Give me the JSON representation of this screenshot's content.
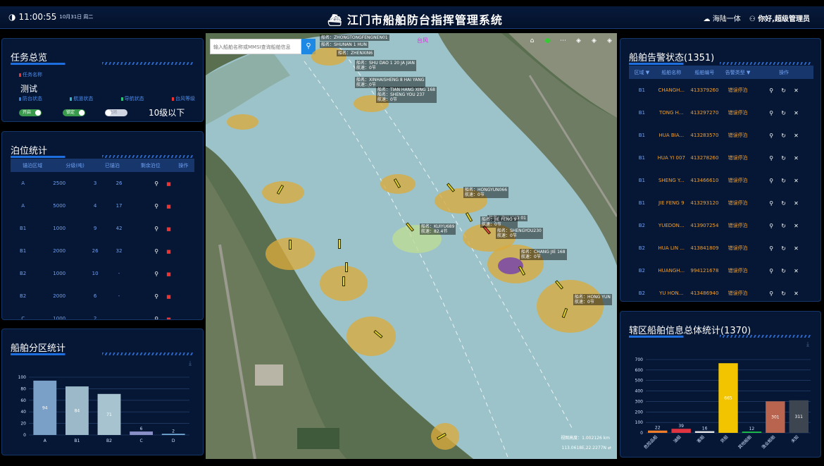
{
  "header": {
    "time": "11:00:55",
    "date": "10月31日 周二",
    "title": "江门市船舶防台指挥管理系统",
    "menu": "海陆一体",
    "user": "你好,超级管理员"
  },
  "task": {
    "title": "任务总览",
    "name_label": "任务名称",
    "name_value": "测试",
    "status_labels": [
      "防台状态",
      "航道状态",
      "导航状态",
      "台风等级"
    ],
    "toggles": [
      "开启",
      "锁定",
      "关闭"
    ],
    "typhoon_level": "10级以下"
  },
  "berth": {
    "title": "泊位统计",
    "headers": [
      "锚泊区域",
      "分级(吨)",
      "已锚泊",
      "剩余泊位",
      "操作"
    ],
    "rows": [
      [
        "A",
        "2500",
        "3",
        "26"
      ],
      [
        "A",
        "5000",
        "4",
        "17"
      ],
      [
        "B1",
        "1000",
        "9",
        "42"
      ],
      [
        "B1",
        "2000",
        "26",
        "32"
      ],
      [
        "B2",
        "1000",
        "10",
        "-"
      ],
      [
        "B2",
        "2000",
        "6",
        "-"
      ],
      [
        "C",
        "1000",
        "2",
        ""
      ]
    ]
  },
  "zone_chart": {
    "title": "船舶分区统计"
  },
  "alarm": {
    "title": "船舶告警状态(1351)",
    "headers": [
      "区域",
      "船舶名称",
      "船舶编号",
      "告警类型",
      "操作"
    ],
    "rows": [
      [
        "B1",
        "CHANGH...",
        "413379260",
        "错误停泊"
      ],
      [
        "B1",
        "TONG H...",
        "413297270",
        "错误停泊"
      ],
      [
        "B1",
        "HUA BIA...",
        "413283570",
        "错误停泊"
      ],
      [
        "B1",
        "HUA YI 007",
        "413278260",
        "错误停泊"
      ],
      [
        "B1",
        "SHENG Y...",
        "413466610",
        "错误停泊"
      ],
      [
        "B1",
        "JIE FENG 9",
        "413293120",
        "错误停泊"
      ],
      [
        "B2",
        "YUEDON...",
        "413907254",
        "错误停泊"
      ],
      [
        "B2",
        "HUA LIN ...",
        "413841809",
        "错误停泊"
      ],
      [
        "B2",
        "HUANGH...",
        "994121678",
        "错误停泊"
      ],
      [
        "B2",
        "YU HON...",
        "413486940",
        "错误停泊"
      ]
    ]
  },
  "info_chart": {
    "title": "辖区船舶信息总体统计(1370)"
  },
  "map": {
    "search_placeholder": "输入船舶名称或MMSI查询船舶信息",
    "magenta_label": "台风",
    "scale": "视图高度：1.002126 km",
    "coords": "113.0618E,22.2277N",
    "vessels": [
      {
        "name": "船名：ZHONGTONGFENGNEN01"
      },
      {
        "name": "船名：SHUNAN 1 HUN"
      },
      {
        "name": "船名：ZHENXIN6"
      },
      {
        "name": "船名：SHU DAO 1 20 JA JIAN"
      },
      {
        "name": "船名：XINHAISHENG 8  HAI YANG"
      },
      {
        "name": "船名：TIAN HANG XING 168"
      },
      {
        "name": "船名：SHENG YOU 237"
      },
      {
        "name": "船名：HONGYUN066"
      },
      {
        "name": "船名：ZHI XUG 01"
      },
      {
        "name": "船名：JIE FENG 9"
      },
      {
        "name": "船名：SHENGYOU230"
      },
      {
        "name": "船名：KUIYU689"
      },
      {
        "name": "船名：CHANG JIE 168"
      },
      {
        "name": "船名：HONG YUN"
      }
    ],
    "speed_label": "航速：0节",
    "speed_kuiyu": "航速：82.4节"
  },
  "chart_data": [
    {
      "type": "bar",
      "title": "船舶分区统计",
      "categories": [
        "A",
        "B1",
        "B2",
        "C",
        "D"
      ],
      "values": [
        94,
        84,
        71,
        6,
        2
      ],
      "ylim": [
        0,
        100
      ],
      "yticks": [
        0,
        20,
        40,
        60,
        80,
        100
      ],
      "colors": [
        "#7ba0c8",
        "#9bb9c9",
        "#a7c3cf",
        "#8b8fc8",
        "#7ab3e2"
      ]
    },
    {
      "type": "bar",
      "title": "辖区船舶信息总体统计(1370)",
      "categories": [
        "危险品船",
        "油船",
        "客船",
        "货船",
        "其他船舶",
        "渔业船舶",
        "未知"
      ],
      "values": [
        22,
        39,
        16,
        665,
        12,
        301,
        311
      ],
      "ylim": [
        0,
        700
      ],
      "yticks": [
        0,
        100,
        200,
        300,
        400,
        500,
        600,
        700
      ],
      "colors": [
        "#f07d2a",
        "#e03540",
        "#e7e7e7",
        "#f2c400",
        "#1ec64a",
        "#b8644e",
        "#3d4650"
      ]
    }
  ]
}
